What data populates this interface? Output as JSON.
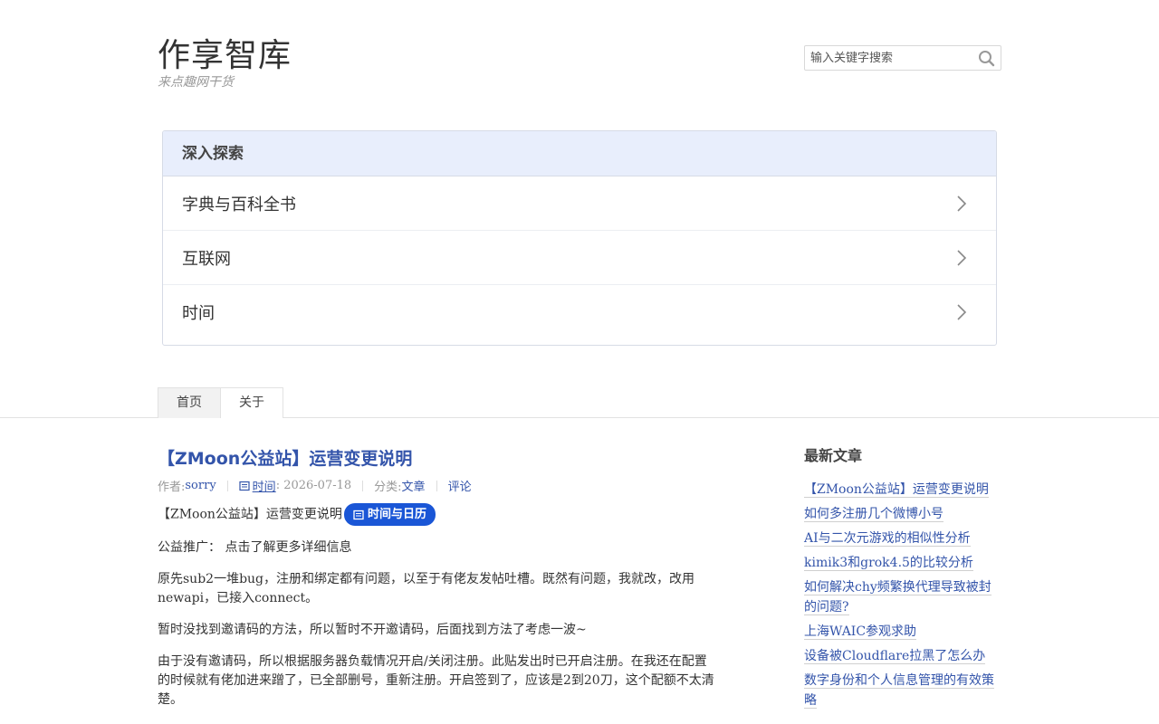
{
  "site": {
    "title": "作享智库",
    "description": "来点趣网干货"
  },
  "search": {
    "placeholder": "输入关键字搜索"
  },
  "explore": {
    "heading": "深入探索",
    "items": [
      {
        "label": "字典与百科全书"
      },
      {
        "label": "互联网"
      },
      {
        "label": "时间"
      }
    ]
  },
  "nav": {
    "tabs": [
      {
        "label": "首页",
        "active": true
      },
      {
        "label": "关于",
        "active": false
      }
    ]
  },
  "post": {
    "title": "【ZMoon公益站】运营变更说明",
    "meta": {
      "author_label": "作者: ",
      "author": "sorry",
      "time_label": "时间",
      "time": ": 2026-07-18",
      "category_label": "分类: ",
      "category": "文章",
      "comments": "评论"
    },
    "intro": "【ZMoon公益站】运营变更说明",
    "pill_label": "时间与日历",
    "paragraphs": [
      "公益推广： 点击了解更多详细信息",
      "原先sub2一堆bug，注册和绑定都有问题，以至于有佬友发帖吐槽。既然有问题，我就改，改用newapi，已接入connect。",
      "暂时没找到邀请码的方法，所以暂时不开邀请码，后面找到方法了考虑一波~",
      "由于没有邀请码，所以根据服务器负载情况开启/关闭注册。此贴发出时已开启注册。在我还在配置的时候就有佬加进来蹭了，已全部删号，重新注册。开启签到了，应该是2到20刀，这个配额不太清楚。"
    ]
  },
  "sidebar": {
    "heading": "最新文章",
    "recent": [
      "【ZMoon公益站】运营变更说明",
      "如何多注册几个微博小号",
      "AI与二次元游戏的相似性分析",
      "kimik3和grok4.5的比较分析",
      "如何解决chy频繁换代理导致被封的问题?",
      "上海WAIC参观求助",
      "设备被Cloudflare拉黑了怎么办",
      "数字身份和个人信息管理的有效策略"
    ]
  },
  "colors": {
    "link": "#3354AA",
    "pill": "#1a56d6",
    "explore_header": "#e8eefc"
  }
}
